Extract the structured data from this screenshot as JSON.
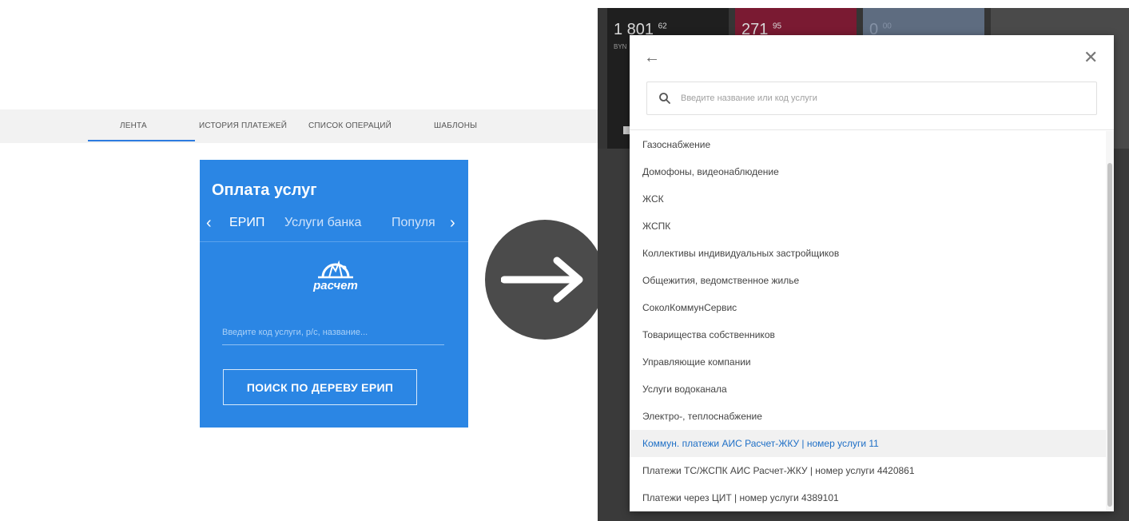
{
  "tabs": [
    {
      "label": "ЛЕНТА",
      "active": true
    },
    {
      "label": "ИСТОРИЯ ПЛАТЕЖЕЙ"
    },
    {
      "label": "СПИСОК ОПЕРАЦИЙ"
    },
    {
      "label": "ШАБЛОНЫ"
    }
  ],
  "payment_card": {
    "title": "Оплата услуг",
    "tabs": [
      {
        "label": "ЕРИП",
        "active": true
      },
      {
        "label": "Услуги банка"
      },
      {
        "label": "Популя"
      }
    ],
    "logo_text": "расчет",
    "input_placeholder": "Введите код услуги, р/с, название...",
    "tree_button": "ПОИСК ПО ДЕРЕВУ ЕРИП",
    "background_color": "#2b86e4"
  },
  "dashboard": {
    "accounts": [
      {
        "amount": "1 801",
        "cents": "62",
        "currency": "BYN"
      },
      {
        "amount": "271",
        "cents": "95",
        "currency": ""
      },
      {
        "amount": "0",
        "cents": "00",
        "currency": ""
      }
    ]
  },
  "modal": {
    "search_placeholder": "Введите название или код услуги",
    "items": [
      {
        "label": "Газоснабжение"
      },
      {
        "label": "Домофоны, видеонаблюдение"
      },
      {
        "label": "ЖСК"
      },
      {
        "label": "ЖСПК"
      },
      {
        "label": "Коллективы индивидуальных застройщиков"
      },
      {
        "label": "Общежития, ведомственное жилье"
      },
      {
        "label": "СоколКоммунСервис"
      },
      {
        "label": "Товарищества собственников"
      },
      {
        "label": "Управляющие компании"
      },
      {
        "label": "Услуги водоканала"
      },
      {
        "label": "Электро-, теплоснабжение"
      },
      {
        "label": "Коммун. платежи АИС Расчет-ЖКУ | номер услуги 11",
        "highlighted": true
      },
      {
        "label": "Платежи ТС/ЖСПК АИС Расчет-ЖКУ | номер услуги 4420861"
      },
      {
        "label": "Платежи через ЦИТ | номер услуги 4389101"
      }
    ],
    "highlight_color": "#1e6fc6"
  },
  "icons": {
    "arrow": "arrow-right-icon",
    "back": "arrow-left-icon",
    "close": "close-icon",
    "search": "search-icon"
  }
}
